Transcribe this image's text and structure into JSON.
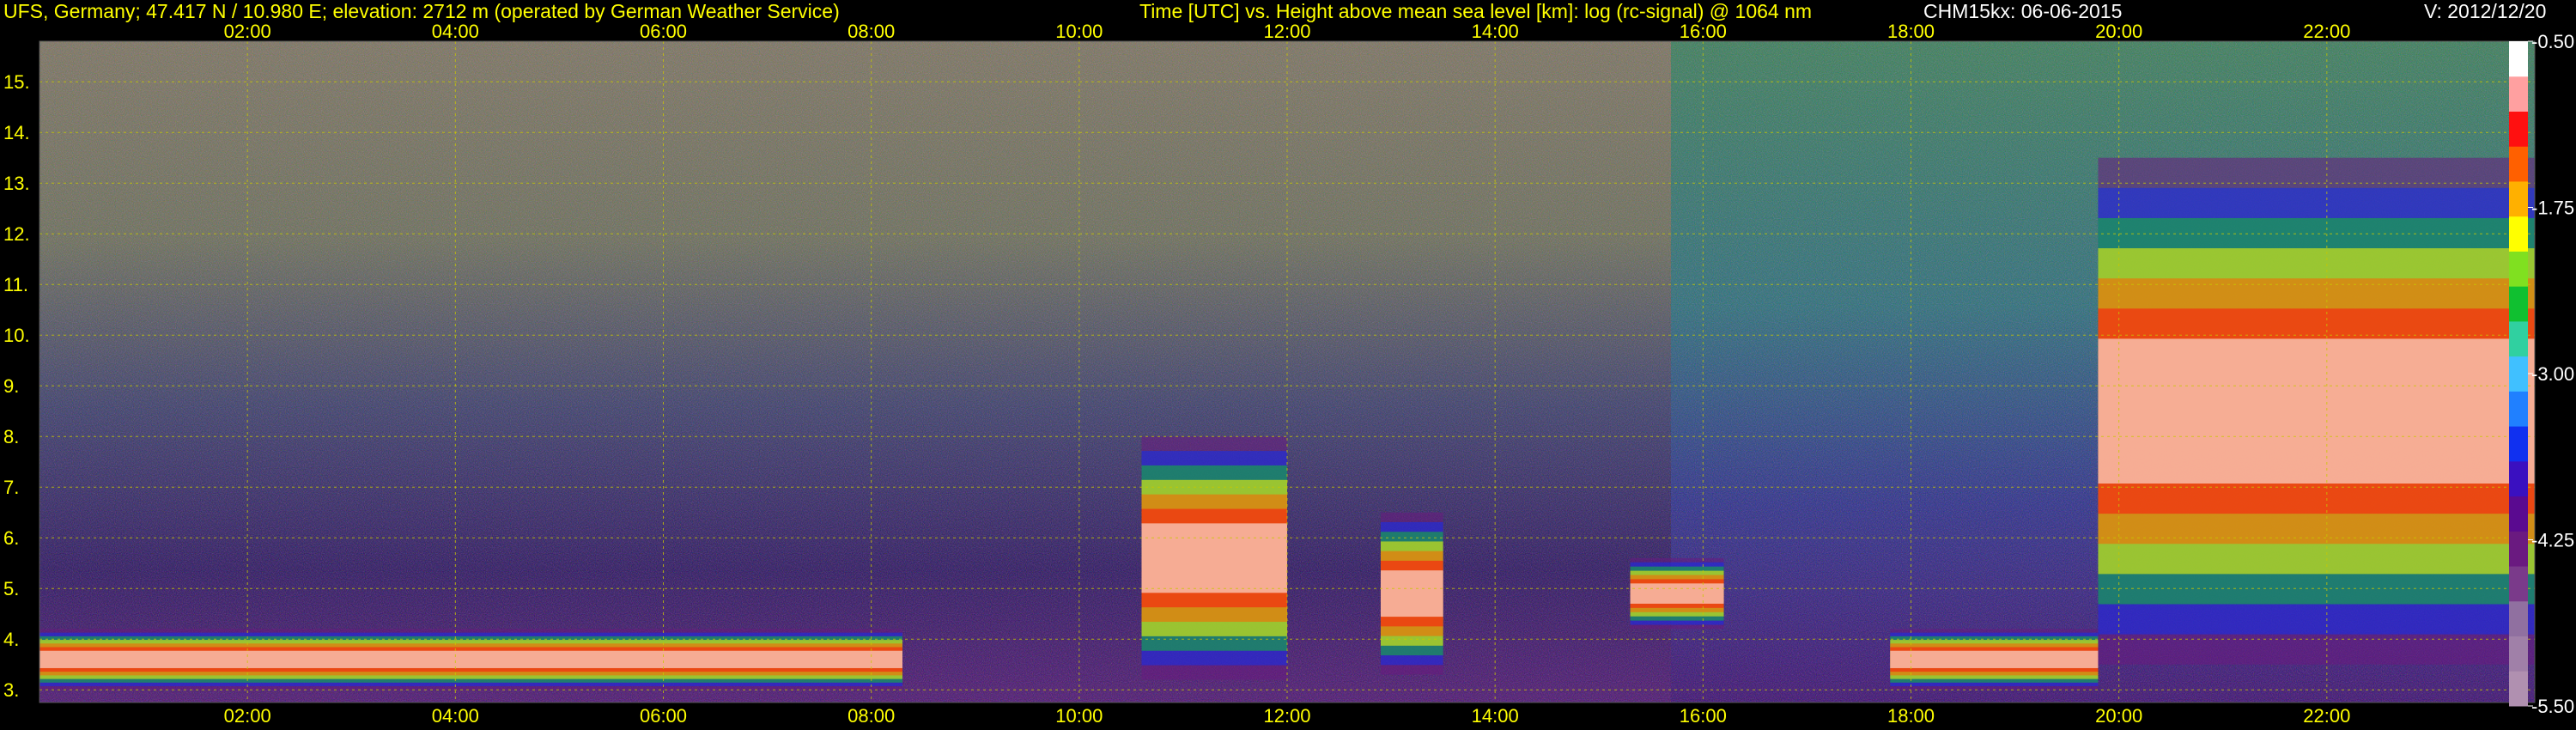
{
  "header": {
    "station": "UFS, Germany; 47.417 N / 10.980 E; elevation: 2712 m  (operated by German Weather Service)",
    "axes_desc": "Time [UTC] vs. Height above mean sea level [km]: log (rc-signal) @ 1064 nm",
    "instrument": "CHM15kx: 06-06-2015",
    "version": "V: 2012/12/20"
  },
  "colors": {
    "text": "#ffff00",
    "white_text": "#ffffff",
    "grid": "#c8c800",
    "background": "#000000"
  },
  "chart_data": {
    "type": "heatmap",
    "title": "Time [UTC] vs. Height above mean sea level [km]: log (rc-signal) @ 1064 nm",
    "xlabel": "Time [UTC]",
    "ylabel": "Height above mean sea level [km]",
    "x_ticks": [
      "02:00",
      "04:00",
      "06:00",
      "08:00",
      "10:00",
      "12:00",
      "14:00",
      "16:00",
      "18:00",
      "20:00",
      "22:00"
    ],
    "x_tick_hours": [
      2,
      4,
      6,
      8,
      10,
      12,
      14,
      16,
      18,
      20,
      22
    ],
    "xlim_hours": [
      0,
      24
    ],
    "y_ticks": [
      "3.",
      "4.",
      "5.",
      "6.",
      "7.",
      "8.",
      "9.",
      "10.",
      "11.",
      "12.",
      "13.",
      "14.",
      "15."
    ],
    "y_tick_values": [
      3,
      4,
      5,
      6,
      7,
      8,
      9,
      10,
      11,
      12,
      13,
      14,
      15
    ],
    "ylim_km": [
      2.75,
      15.8
    ],
    "colorbar": {
      "tick_labels": [
        "-0.50",
        "-1.75",
        "-3.00",
        "-4.25",
        "-5.50"
      ],
      "tick_values": [
        -0.5,
        -1.75,
        -3.0,
        -4.25,
        -5.5
      ],
      "range": [
        -5.5,
        -0.5
      ],
      "colors": [
        "#b090b0",
        "#a080a8",
        "#9070a0",
        "#7a3a8a",
        "#6a1a80",
        "#5a0a90",
        "#3a10c0",
        "#1030f0",
        "#2080ff",
        "#40c0ff",
        "#30d0a0",
        "#10c030",
        "#80e020",
        "#ffff00",
        "#ffb000",
        "#ff6000",
        "#ff1010",
        "#ffa0a0",
        "#ffffff"
      ]
    },
    "features": [
      {
        "name": "boundary_layer_morning",
        "start_h": 0.0,
        "end_h": 8.3,
        "base_km": 3.0,
        "top_km": 4.2
      },
      {
        "name": "cloud_1030_1200",
        "start_h": 10.6,
        "end_h": 12.0,
        "base_km": 3.2,
        "top_km": 8.0
      },
      {
        "name": "cloud_1300_1330",
        "start_h": 12.9,
        "end_h": 13.5,
        "base_km": 3.3,
        "top_km": 6.5
      },
      {
        "name": "cloud_1500_1620",
        "start_h": 15.3,
        "end_h": 16.2,
        "base_km": 4.2,
        "top_km": 5.6
      },
      {
        "name": "cloud_1800_2000",
        "start_h": 17.8,
        "end_h": 19.8,
        "base_km": 3.0,
        "top_km": 4.2
      },
      {
        "name": "cloud_2000_2400",
        "start_h": 19.8,
        "end_h": 24.0,
        "base_km": 3.5,
        "top_km": 13.5
      }
    ]
  }
}
